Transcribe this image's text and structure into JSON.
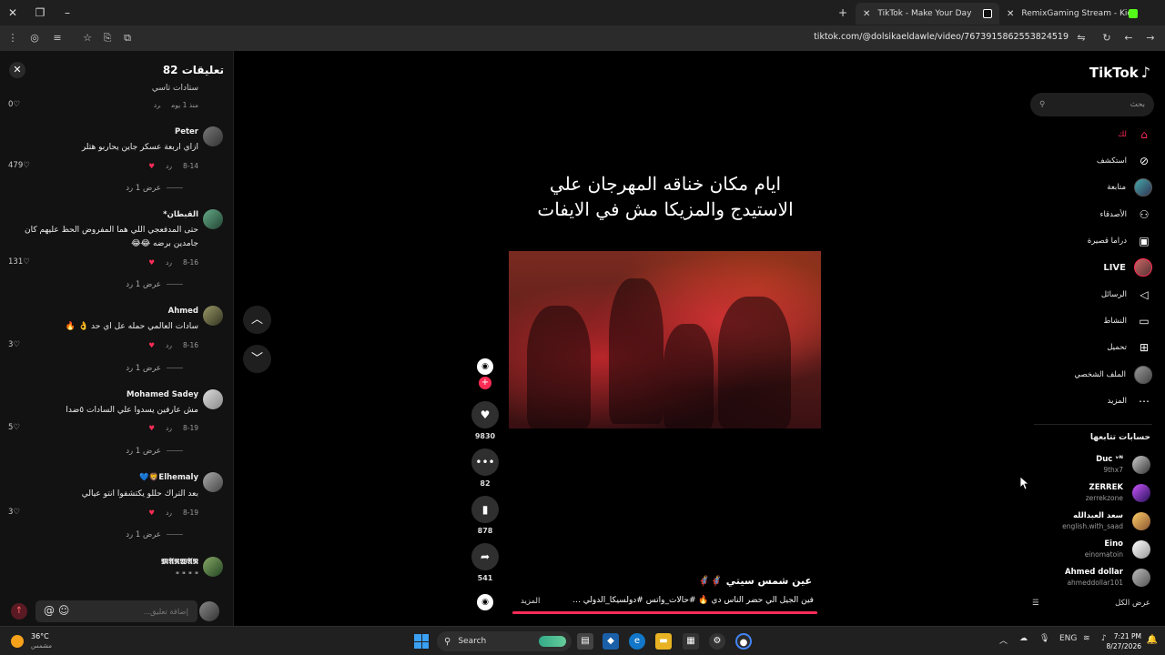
{
  "browser": {
    "tabs": [
      {
        "label": "TikTok - Make Your Day"
      },
      {
        "label": "RemixGaming Stream - Kick Da"
      }
    ],
    "url": "tiktok.com/@dolsikaeldawle/video/7673915862553824519"
  },
  "comments": {
    "title": "تعليقات 82",
    "partial_text": "ستادات تاسي",
    "partial_meta": "منذ 1 يوم",
    "reply_label": "رد",
    "items": [
      {
        "user": "Peter",
        "text": "ازاي اربعة عسكر جاين يحاربو هتلر",
        "date": "8-14",
        "likes": "479",
        "more": "عرض 1 رد"
      },
      {
        "user": "القبطان*",
        "text": "حتى المدفعجي اللي هما المفروض الحظ عليهم كان جامدين برضه 😂😂",
        "date": "8-16",
        "likes": "131",
        "more": "عرض 1 رد"
      },
      {
        "user": "Ahmed",
        "text": "سادات العالمي حمله عل اي حد 👌 🔥",
        "date": "8-16",
        "likes": "3",
        "more": "عرض 1 رد"
      },
      {
        "user": "Mohamed Sadey",
        "text": "مش عارفين يسدوا علي السادات ٥ضدا",
        "date": "8-19",
        "likes": "5",
        "more": "عرض 1 رد"
      },
      {
        "user": "Elhemaly🦁💙",
        "text": "بعد التراك حللو يكتشفوا انتو عيالي",
        "date": "8-19",
        "likes": "3",
        "more": "عرض 1 رد"
      },
      {
        "user": "𝕸𝕬𝕽𝖂𝕬𝕹",
        "text": "\" \" \" \"",
        "date": "",
        "likes": "",
        "more": ""
      }
    ],
    "partial_likes": "0",
    "input_placeholder": "إضافة تعليق..."
  },
  "video": {
    "title_line1": "ايام مكان خناقه المهرجان علي",
    "title_line2": "الاستيدج والمزيكا مش في الايفات",
    "author": "عين شمس سيتي 🦸‍♂️🦸‍♂️",
    "caption": "فين الجيل الي حضر الناس دي 🔥 #حالات_واتس #دولسيكا_الدولي ...",
    "more_label": "المزيد",
    "progress": 1.0
  },
  "actions": {
    "likes": "9830",
    "comments": "82",
    "saves": "878",
    "shares": "541"
  },
  "sidebar": {
    "logo": "TikTok",
    "search_placeholder": "بحث",
    "nav": [
      {
        "label": "لك",
        "icon": "home-icon"
      },
      {
        "label": "استكشف",
        "icon": "compass-icon"
      },
      {
        "label": "متابعة",
        "icon": "following-avatar"
      },
      {
        "label": "الأصدقاء",
        "icon": "friends-icon"
      },
      {
        "label": "دراما قصيرة",
        "icon": "drama-icon"
      },
      {
        "label": "LIVE",
        "icon": "live-avatar"
      },
      {
        "label": "الرسائل",
        "icon": "messages-icon"
      },
      {
        "label": "النشاط",
        "icon": "activity-icon"
      },
      {
        "label": "تحميل",
        "icon": "upload-icon"
      },
      {
        "label": "الملف الشخصي",
        "icon": "profile-avatar"
      },
      {
        "label": "المزيد",
        "icon": "more-icon"
      }
    ],
    "following_title": "حسابات تتابعها",
    "following": [
      {
        "name": "Duc ᵛᴺ",
        "handle": "9thx7"
      },
      {
        "name": "ZERREK",
        "handle": "zerrekzone"
      },
      {
        "name": "سعد العبدالله",
        "handle": "english.with_saad"
      },
      {
        "name": "Eino",
        "handle": "einomatoin"
      },
      {
        "name": "Ahmed dollar",
        "handle": "ahmeddollar101"
      }
    ],
    "see_all": "عرض الكل"
  },
  "taskbar": {
    "weather_temp": "36°C",
    "weather_desc": "مشمس",
    "search_label": "Search",
    "lang": "ENG",
    "time": "7:21 PM",
    "date": "8/27/2026"
  },
  "colors": {
    "accent": "#fe2c55",
    "background": "#000000",
    "panel": "#121212"
  }
}
